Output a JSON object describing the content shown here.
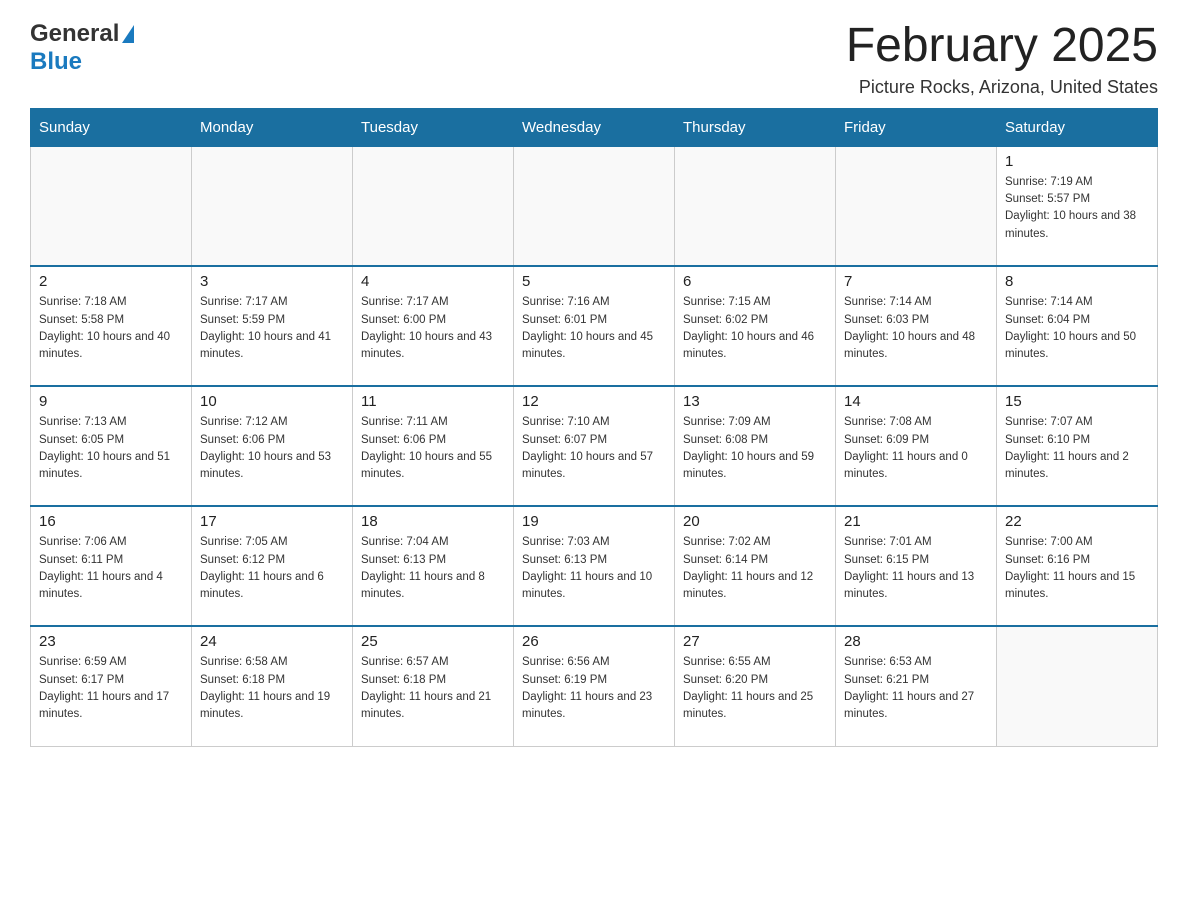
{
  "header": {
    "logo": {
      "general": "General",
      "blue": "Blue",
      "triangle": "▶"
    },
    "title": "February 2025",
    "location": "Picture Rocks, Arizona, United States"
  },
  "days_of_week": [
    "Sunday",
    "Monday",
    "Tuesday",
    "Wednesday",
    "Thursday",
    "Friday",
    "Saturday"
  ],
  "weeks": [
    [
      {
        "day": "",
        "info": ""
      },
      {
        "day": "",
        "info": ""
      },
      {
        "day": "",
        "info": ""
      },
      {
        "day": "",
        "info": ""
      },
      {
        "day": "",
        "info": ""
      },
      {
        "day": "",
        "info": ""
      },
      {
        "day": "1",
        "info": "Sunrise: 7:19 AM\nSunset: 5:57 PM\nDaylight: 10 hours and 38 minutes."
      }
    ],
    [
      {
        "day": "2",
        "info": "Sunrise: 7:18 AM\nSunset: 5:58 PM\nDaylight: 10 hours and 40 minutes."
      },
      {
        "day": "3",
        "info": "Sunrise: 7:17 AM\nSunset: 5:59 PM\nDaylight: 10 hours and 41 minutes."
      },
      {
        "day": "4",
        "info": "Sunrise: 7:17 AM\nSunset: 6:00 PM\nDaylight: 10 hours and 43 minutes."
      },
      {
        "day": "5",
        "info": "Sunrise: 7:16 AM\nSunset: 6:01 PM\nDaylight: 10 hours and 45 minutes."
      },
      {
        "day": "6",
        "info": "Sunrise: 7:15 AM\nSunset: 6:02 PM\nDaylight: 10 hours and 46 minutes."
      },
      {
        "day": "7",
        "info": "Sunrise: 7:14 AM\nSunset: 6:03 PM\nDaylight: 10 hours and 48 minutes."
      },
      {
        "day": "8",
        "info": "Sunrise: 7:14 AM\nSunset: 6:04 PM\nDaylight: 10 hours and 50 minutes."
      }
    ],
    [
      {
        "day": "9",
        "info": "Sunrise: 7:13 AM\nSunset: 6:05 PM\nDaylight: 10 hours and 51 minutes."
      },
      {
        "day": "10",
        "info": "Sunrise: 7:12 AM\nSunset: 6:06 PM\nDaylight: 10 hours and 53 minutes."
      },
      {
        "day": "11",
        "info": "Sunrise: 7:11 AM\nSunset: 6:06 PM\nDaylight: 10 hours and 55 minutes."
      },
      {
        "day": "12",
        "info": "Sunrise: 7:10 AM\nSunset: 6:07 PM\nDaylight: 10 hours and 57 minutes."
      },
      {
        "day": "13",
        "info": "Sunrise: 7:09 AM\nSunset: 6:08 PM\nDaylight: 10 hours and 59 minutes."
      },
      {
        "day": "14",
        "info": "Sunrise: 7:08 AM\nSunset: 6:09 PM\nDaylight: 11 hours and 0 minutes."
      },
      {
        "day": "15",
        "info": "Sunrise: 7:07 AM\nSunset: 6:10 PM\nDaylight: 11 hours and 2 minutes."
      }
    ],
    [
      {
        "day": "16",
        "info": "Sunrise: 7:06 AM\nSunset: 6:11 PM\nDaylight: 11 hours and 4 minutes."
      },
      {
        "day": "17",
        "info": "Sunrise: 7:05 AM\nSunset: 6:12 PM\nDaylight: 11 hours and 6 minutes."
      },
      {
        "day": "18",
        "info": "Sunrise: 7:04 AM\nSunset: 6:13 PM\nDaylight: 11 hours and 8 minutes."
      },
      {
        "day": "19",
        "info": "Sunrise: 7:03 AM\nSunset: 6:13 PM\nDaylight: 11 hours and 10 minutes."
      },
      {
        "day": "20",
        "info": "Sunrise: 7:02 AM\nSunset: 6:14 PM\nDaylight: 11 hours and 12 minutes."
      },
      {
        "day": "21",
        "info": "Sunrise: 7:01 AM\nSunset: 6:15 PM\nDaylight: 11 hours and 13 minutes."
      },
      {
        "day": "22",
        "info": "Sunrise: 7:00 AM\nSunset: 6:16 PM\nDaylight: 11 hours and 15 minutes."
      }
    ],
    [
      {
        "day": "23",
        "info": "Sunrise: 6:59 AM\nSunset: 6:17 PM\nDaylight: 11 hours and 17 minutes."
      },
      {
        "day": "24",
        "info": "Sunrise: 6:58 AM\nSunset: 6:18 PM\nDaylight: 11 hours and 19 minutes."
      },
      {
        "day": "25",
        "info": "Sunrise: 6:57 AM\nSunset: 6:18 PM\nDaylight: 11 hours and 21 minutes."
      },
      {
        "day": "26",
        "info": "Sunrise: 6:56 AM\nSunset: 6:19 PM\nDaylight: 11 hours and 23 minutes."
      },
      {
        "day": "27",
        "info": "Sunrise: 6:55 AM\nSunset: 6:20 PM\nDaylight: 11 hours and 25 minutes."
      },
      {
        "day": "28",
        "info": "Sunrise: 6:53 AM\nSunset: 6:21 PM\nDaylight: 11 hours and 27 minutes."
      },
      {
        "day": "",
        "info": ""
      }
    ]
  ]
}
